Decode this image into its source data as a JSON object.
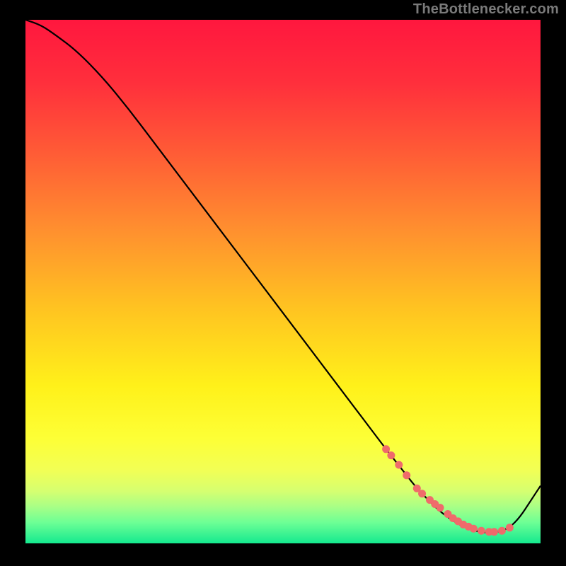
{
  "attribution": "TheBottlenecker.com",
  "chart_data": {
    "type": "line",
    "title": "",
    "xlabel": "",
    "ylabel": "",
    "xlim": [
      0,
      100
    ],
    "ylim": [
      0,
      100
    ],
    "series": [
      {
        "name": "bottleneck-curve",
        "color": "#000000",
        "x": [
          0,
          3,
          6,
          10,
          15,
          20,
          25,
          30,
          35,
          40,
          45,
          50,
          55,
          60,
          65,
          70,
          72,
          74,
          76,
          78,
          80,
          82,
          84,
          86,
          88,
          90,
          92,
          94,
          96,
          98,
          100
        ],
        "y": [
          100,
          99,
          97,
          94,
          89,
          83,
          76.5,
          70,
          63.5,
          57,
          50.5,
          44,
          37.5,
          31,
          24.5,
          18,
          15.5,
          13,
          10.5,
          8.5,
          6.5,
          5,
          3.7,
          2.8,
          2.2,
          2,
          2.2,
          3,
          5,
          8,
          11
        ]
      }
    ],
    "points": {
      "name": "highlight-dots",
      "color": "#ef6b6b",
      "x": [
        70,
        71,
        72.5,
        74,
        76,
        77,
        78.5,
        79.5,
        80.5,
        82,
        83,
        84,
        85,
        86,
        87,
        88.5,
        90,
        91,
        92.5,
        94
      ],
      "y": [
        18,
        16.8,
        15,
        13,
        10.5,
        9.5,
        8.3,
        7.5,
        6.8,
        5.6,
        4.8,
        4.2,
        3.6,
        3.2,
        2.8,
        2.4,
        2.2,
        2.2,
        2.4,
        3
      ]
    },
    "gradient_stops": [
      {
        "pct": 0,
        "color": "#ff173e"
      },
      {
        "pct": 12,
        "color": "#ff2f3c"
      },
      {
        "pct": 25,
        "color": "#ff5a36"
      },
      {
        "pct": 40,
        "color": "#ff8f2f"
      },
      {
        "pct": 55,
        "color": "#ffc321"
      },
      {
        "pct": 70,
        "color": "#fff11a"
      },
      {
        "pct": 80,
        "color": "#fdff36"
      },
      {
        "pct": 86,
        "color": "#f2ff55"
      },
      {
        "pct": 90,
        "color": "#d6ff70"
      },
      {
        "pct": 93,
        "color": "#a8ff86"
      },
      {
        "pct": 96,
        "color": "#6dff95"
      },
      {
        "pct": 100,
        "color": "#14e98f"
      }
    ]
  }
}
